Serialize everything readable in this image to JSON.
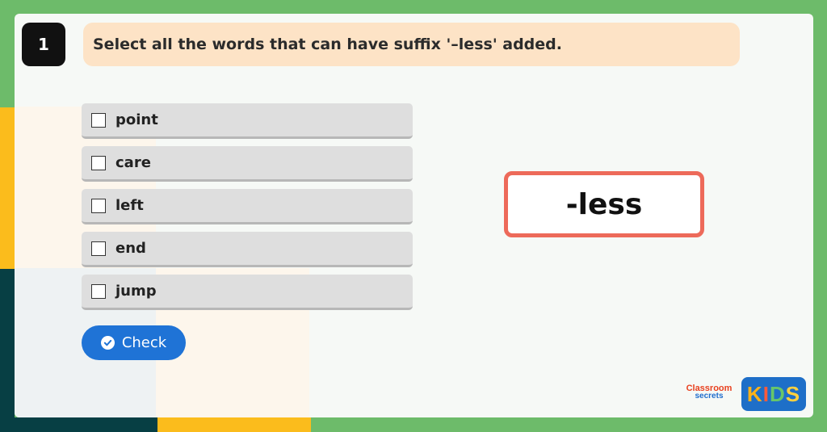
{
  "question": {
    "number": "1",
    "text": "Select all the words that can have suffix '–less' added."
  },
  "options": [
    {
      "label": "point",
      "checked": false
    },
    {
      "label": "care",
      "checked": false
    },
    {
      "label": "left",
      "checked": false
    },
    {
      "label": "end",
      "checked": false
    },
    {
      "label": "jump",
      "checked": false
    }
  ],
  "check_button": {
    "label": "Check",
    "icon": "check-circle-icon"
  },
  "suffix": "-less",
  "logos": {
    "classroom_secrets_top": "Classroom",
    "classroom_secrets_bottom": "secrets",
    "kids_letters": [
      "K",
      "I",
      "D",
      "S"
    ]
  },
  "colors": {
    "background_green": "#6dbb6a",
    "question_bg": "#fde3c6",
    "option_bg": "#dedede",
    "button_blue": "#1f73d6",
    "suffix_border": "#ed6a5a"
  }
}
